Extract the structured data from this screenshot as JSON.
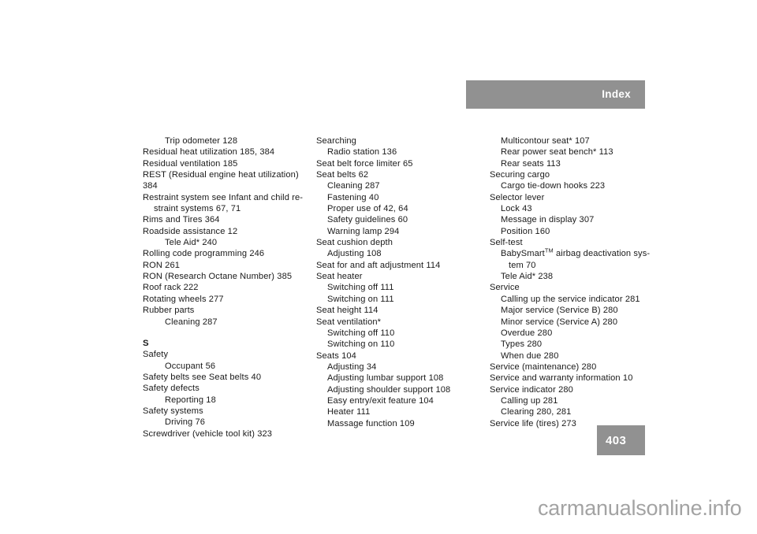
{
  "header": {
    "title": "Index",
    "bar_color": "#919191",
    "text_color": "#ffffff"
  },
  "page_number": {
    "value": "403",
    "bar_color": "#919191",
    "text_color": "#ffffff"
  },
  "watermark": {
    "text": "carmanualsonline.info",
    "color": "#a3a3a3"
  },
  "index": {
    "columns": [
      {
        "id": "column-1",
        "entries": [
          {
            "text": "Trip odometer 128",
            "level": 2
          },
          {
            "text": "Residual heat utilization 185, 384",
            "level": 0
          },
          {
            "text": "Residual ventilation 185",
            "level": 0
          },
          {
            "text": "REST (Residual engine heat utilization) 384",
            "level": 0
          },
          {
            "text": "Restraint system see Infant and child re-",
            "level": 0
          },
          {
            "text": "straint systems 67, 71",
            "level": 0,
            "wrap": 1
          },
          {
            "text": "Rims and Tires 364",
            "level": 0
          },
          {
            "text": "Roadside assistance 12",
            "level": 0
          },
          {
            "text": "Tele Aid* 240",
            "level": 2
          },
          {
            "text": "Rolling code programming 246",
            "level": 0
          },
          {
            "text": "RON 261",
            "level": 0
          },
          {
            "text": "RON (Research Octane Number) 385",
            "level": 0
          },
          {
            "text": "Roof rack 222",
            "level": 0
          },
          {
            "text": "Rotating wheels 277",
            "level": 0
          },
          {
            "text": "Rubber parts",
            "level": 0
          },
          {
            "text": "Cleaning 287",
            "level": 2
          },
          {
            "text": "S",
            "level": 0,
            "section": true
          },
          {
            "text": "Safety",
            "level": 0
          },
          {
            "text": "Occupant 56",
            "level": 2
          },
          {
            "text": "Safety belts see Seat belts 40",
            "level": 0
          },
          {
            "text": "Safety defects",
            "level": 0
          },
          {
            "text": "Reporting 18",
            "level": 2
          },
          {
            "text": "Safety systems",
            "level": 0
          },
          {
            "text": "Driving 76",
            "level": 2
          },
          {
            "text": "Screwdriver (vehicle tool kit) 323",
            "level": 0
          }
        ]
      },
      {
        "id": "column-2",
        "entries": [
          {
            "text": "Searching",
            "level": 0
          },
          {
            "text": "Radio station 136",
            "level": 1
          },
          {
            "text": "Seat belt force limiter 65",
            "level": 0
          },
          {
            "text": "Seat belts 62",
            "level": 0
          },
          {
            "text": "Cleaning 287",
            "level": 1
          },
          {
            "text": "Fastening 40",
            "level": 1
          },
          {
            "text": "Proper use of 42, 64",
            "level": 1
          },
          {
            "text": "Safety guidelines 60",
            "level": 1
          },
          {
            "text": "Warning lamp 294",
            "level": 1
          },
          {
            "text": "Seat cushion depth",
            "level": 0
          },
          {
            "text": "Adjusting 108",
            "level": 1
          },
          {
            "text": "Seat for and aft adjustment 114",
            "level": 0
          },
          {
            "text": "Seat heater",
            "level": 0
          },
          {
            "text": "Switching off 111",
            "level": 1
          },
          {
            "text": "Switching on 111",
            "level": 1
          },
          {
            "text": "Seat height 114",
            "level": 0
          },
          {
            "text": "Seat ventilation*",
            "level": 0
          },
          {
            "text": "Switching off 110",
            "level": 1
          },
          {
            "text": "Switching on 110",
            "level": 1
          },
          {
            "text": "Seats 104",
            "level": 0
          },
          {
            "text": "Adjusting 34",
            "level": 1
          },
          {
            "text": "Adjusting lumbar support 108",
            "level": 1
          },
          {
            "text": "Adjusting shoulder support 108",
            "level": 1
          },
          {
            "text": "Easy entry/exit feature 104",
            "level": 1
          },
          {
            "text": "Heater 111",
            "level": 1
          },
          {
            "text": "Massage function 109",
            "level": 1
          }
        ]
      },
      {
        "id": "column-3",
        "entries": [
          {
            "text": "Multicontour seat* 107",
            "level": 1
          },
          {
            "text": "Rear power seat bench* 113",
            "level": 1
          },
          {
            "text": "Rear seats 113",
            "level": 1
          },
          {
            "text": "Securing cargo",
            "level": 0
          },
          {
            "text": "Cargo tie-down hooks 223",
            "level": 1
          },
          {
            "text": "Selector lever",
            "level": 0
          },
          {
            "text": "Lock 43",
            "level": 1
          },
          {
            "text": "Message in display 307",
            "level": 1
          },
          {
            "text": "Position 160",
            "level": 1
          },
          {
            "text": "Self-test",
            "level": 0
          },
          {
            "text": "BabySmart",
            "sup": "TM",
            "text_after": " airbag deactivation sys-",
            "level": 1
          },
          {
            "text": "tem 70",
            "level": 0,
            "wrap": 2
          },
          {
            "text": "Tele Aid* 238",
            "level": 1
          },
          {
            "text": "Service",
            "level": 0
          },
          {
            "text": "Calling up the service indicator 281",
            "level": 1
          },
          {
            "text": "Major service (Service B) 280",
            "level": 1
          },
          {
            "text": "Minor service (Service A) 280",
            "level": 1
          },
          {
            "text": "Overdue 280",
            "level": 1
          },
          {
            "text": "Types 280",
            "level": 1
          },
          {
            "text": "When due 280",
            "level": 1
          },
          {
            "text": "Service (maintenance) 280",
            "level": 0
          },
          {
            "text": "Service and warranty information 10",
            "level": 0
          },
          {
            "text": "Service indicator 280",
            "level": 0
          },
          {
            "text": "Calling up 281",
            "level": 1
          },
          {
            "text": "Clearing 280, 281",
            "level": 1
          },
          {
            "text": "Service life (tires) 273",
            "level": 0
          }
        ]
      }
    ]
  }
}
